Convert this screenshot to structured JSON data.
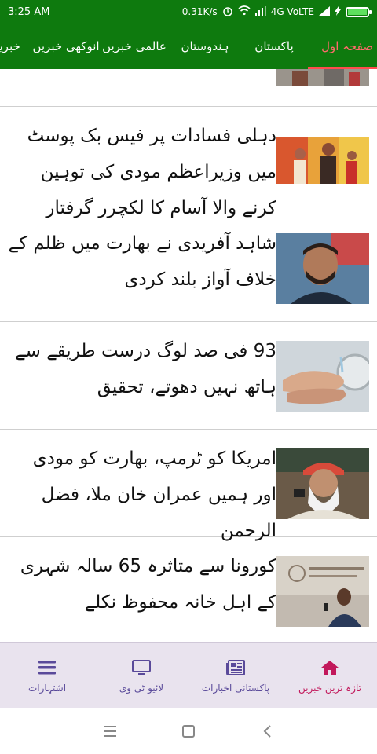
{
  "status_bar": {
    "time": "3:25 AM",
    "net_speed": "0.31K/s",
    "network": "4G VoLTE",
    "battery_level": 1.0
  },
  "tabs": [
    {
      "label": "صفحہ اول",
      "active": true
    },
    {
      "label": "پاکستان",
      "active": false
    },
    {
      "label": "ہندوستان",
      "active": false
    },
    {
      "label": "عالمی خبریں",
      "active": false
    },
    {
      "label": "انوکھی خبریں",
      "active": false
    },
    {
      "label": "خبریں",
      "active": false
    }
  ],
  "news": [
    {
      "title": "دہلی فسادات پر فیس بک پوسٹ میں وزیراعظم مودی کی توہین کرنے والا آسام کا لکچرر گرفتار",
      "image": "man-in-crowd-thumbnail"
    },
    {
      "title": "شاہد آفریدی نے بھارت میں ظلم کے خلاف آواز بلند کردی",
      "image": "shahid-afridi-portrait"
    },
    {
      "title": "93 فی صد لوگ درست طریقے سے ہاتھ نہیں دھوتے، تحقیق",
      "image": "hand-washing-thumbnail"
    },
    {
      "title": "امریکا کو ٹرمپ، بھارت کو مودی اور ہمیں عمران خان ملا، فضل الرحمن",
      "image": "fazl-ur-rehman-at-microphone"
    },
    {
      "title": "کورونا سے متاثرہ 65 سالہ شہری کے اہل خانہ محفوظ نکلے",
      "image": "aga-khan-hospital-thumbnail"
    }
  ],
  "bottom_nav": [
    {
      "label": "اشتہارات",
      "icon": "menu-icon"
    },
    {
      "label": "لائیو ٹی وی",
      "icon": "tv-icon"
    },
    {
      "label": "پاکستانی اخبارات",
      "icon": "newspaper-icon"
    },
    {
      "label": "تازہ ترین خبریں",
      "icon": "home-icon",
      "active": true
    }
  ],
  "colors": {
    "header_green": "#0e7a0e",
    "active_tab": "#ff6b6b",
    "bottom_nav_bg": "#e9e3ee",
    "bottom_nav_text": "#5a4a9a",
    "bottom_nav_active": "#c2185b"
  }
}
